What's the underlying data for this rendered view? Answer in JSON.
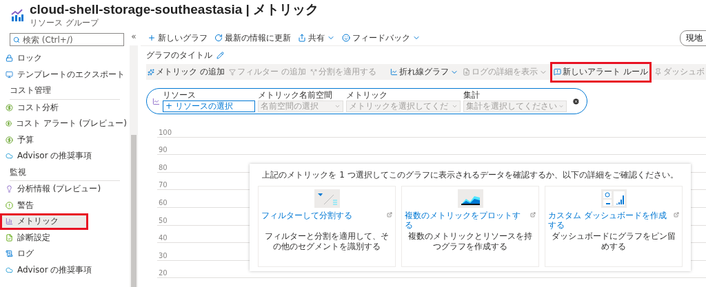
{
  "header": {
    "title": "cloud-shell-storage-southeastasia | メトリック",
    "subtitle": "リソース グループ"
  },
  "sidebar": {
    "search": {
      "placeholder": "検索 (Ctrl+/)"
    },
    "collapse": "«",
    "items": [
      {
        "kind": "item",
        "label": "ロック",
        "selected": false,
        "highlighted": false
      },
      {
        "kind": "item",
        "label": "テンプレートのエクスポート",
        "selected": false,
        "highlighted": false
      },
      {
        "kind": "section",
        "label": "コスト管理"
      },
      {
        "kind": "item",
        "label": "コスト分析",
        "selected": false,
        "highlighted": false
      },
      {
        "kind": "item",
        "label": "コスト アラート (プレビュー)",
        "selected": false,
        "highlighted": false
      },
      {
        "kind": "item",
        "label": "予算",
        "selected": false,
        "highlighted": false
      },
      {
        "kind": "item",
        "label": "Advisor の推奨事項",
        "selected": false,
        "highlighted": false
      },
      {
        "kind": "section",
        "label": "監視"
      },
      {
        "kind": "item",
        "label": "分析情報 (プレビュー)",
        "selected": false,
        "highlighted": false
      },
      {
        "kind": "item",
        "label": "警告",
        "selected": false,
        "highlighted": false
      },
      {
        "kind": "item",
        "label": "メトリック",
        "selected": true,
        "highlighted": true
      },
      {
        "kind": "item",
        "label": "診断設定",
        "selected": false,
        "highlighted": false
      },
      {
        "kind": "item",
        "label": "ログ",
        "selected": false,
        "highlighted": false
      },
      {
        "kind": "item",
        "label": "Advisor の推奨事項",
        "selected": false,
        "highlighted": false
      }
    ]
  },
  "toolbar": {
    "items": [
      {
        "label": "新しいグラフ",
        "dropdown": false
      },
      {
        "label": "最新の情報に更新",
        "dropdown": false
      },
      {
        "label": "共有",
        "dropdown": true
      },
      {
        "label": "フィードバック",
        "dropdown": true
      }
    ],
    "right_button": "現地"
  },
  "chart_title": "グラフのタイトル",
  "chart_toolbar": {
    "left": [
      {
        "label": "メトリック の追加",
        "disabled": false
      },
      {
        "label": "フィルター の追加",
        "disabled": true
      },
      {
        "label": "分割を適用する",
        "disabled": true
      }
    ],
    "right": [
      {
        "label": "折れ線グラフ",
        "disabled": false,
        "dropdown": true,
        "highlighted": false
      },
      {
        "label": "ログの詳細を表示",
        "disabled": true,
        "dropdown": true,
        "highlighted": false
      },
      {
        "label": "新しいアラート ルール",
        "disabled": false,
        "dropdown": false,
        "highlighted": true
      },
      {
        "label": "ダッシュボ",
        "disabled": true,
        "dropdown": false,
        "highlighted": false
      }
    ]
  },
  "metric_selector": {
    "resource": {
      "label": "リソース",
      "value": "+ リソースの選択"
    },
    "fields": [
      {
        "label": "メトリック名前空間",
        "placeholder": "名前空間の選択"
      },
      {
        "label": "メトリック",
        "placeholder": "メトリックを選択してくだ"
      },
      {
        "label": "集計",
        "placeholder": "集計を選択してください"
      }
    ]
  },
  "y_axis_labels": [
    "100",
    "90",
    "80",
    "70",
    "60",
    "50",
    "40",
    "30",
    "20"
  ],
  "overlay": {
    "message": "上記のメトリックを 1 つ選択してこのグラフに表示されるデータを確認するか、以下の詳細をご確認ください。",
    "cards": [
      {
        "title": "フィルターして分割する",
        "description": "フィルターと分割を適用して、その他のセグメントを識別する"
      },
      {
        "title": "複数のメトリックをプロットする",
        "description": "複数のメトリックとリソースを持つグラフを作成する"
      },
      {
        "title": "カスタム ダッシュボードを作成する",
        "description": "ダッシュボードにグラフをピン留めする"
      }
    ]
  }
}
